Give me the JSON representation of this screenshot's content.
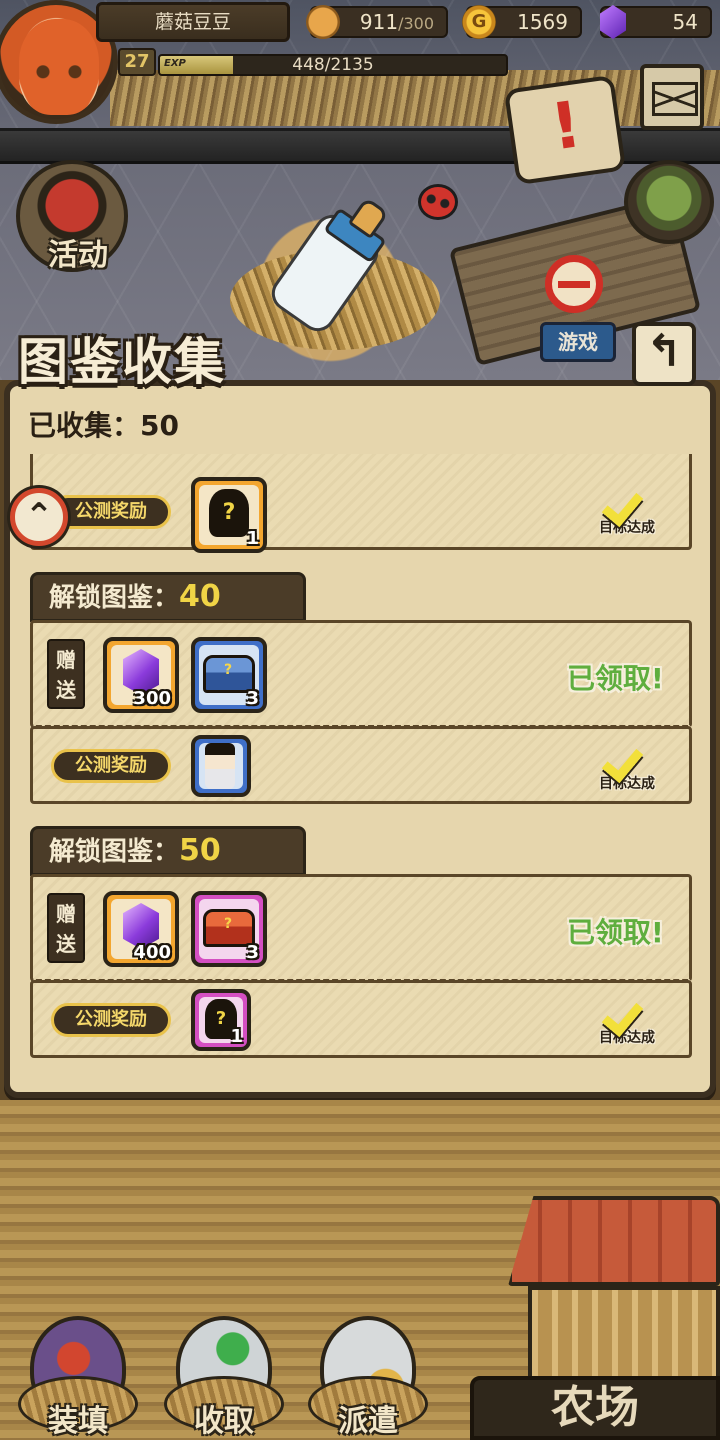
{
  "player": {
    "name": "蘑菇豆豆",
    "level": "27",
    "exp_tag": "EXP",
    "exp_text": "448/2135",
    "exp_progress": 0.21
  },
  "resources": {
    "bread": "911",
    "bread_max": "/300",
    "gold": "1569",
    "gold_symbol": "G",
    "gems": "54"
  },
  "scene": {
    "event_label": "活动",
    "game_tag": "游戏"
  },
  "panel": {
    "title": "图鉴收集",
    "back_symbol": "↰",
    "collected_label": "已收集：50",
    "scroll_up_symbol": "⌃"
  },
  "tiers": [
    {
      "reward_label": "公测奖励",
      "reward_item": {
        "count": "1",
        "symbol": "?"
      },
      "status": "目标达成"
    },
    {
      "header_label": "解锁图鉴：",
      "header_num": "40",
      "gift_label": "赠送",
      "gift_items": [
        {
          "type": "gem",
          "count": "300"
        },
        {
          "type": "blue-chest",
          "count": "3"
        }
      ],
      "claimed": "已领取!",
      "reward_label": "公测奖励",
      "reward_item": {
        "type": "character",
        "count": ""
      },
      "status": "目标达成"
    },
    {
      "header_label": "解锁图鉴：",
      "header_num": "50",
      "gift_label": "赠送",
      "gift_items": [
        {
          "type": "gem",
          "count": "400"
        },
        {
          "type": "red-chest",
          "count": "3"
        }
      ],
      "claimed": "已领取!",
      "reward_label": "公测奖励",
      "reward_item": {
        "count": "1",
        "symbol": "?"
      },
      "status": "目标达成"
    }
  ],
  "bottom_nav": {
    "load": "装填",
    "collect": "收取",
    "dispatch": "派遣",
    "farm": "农场"
  }
}
